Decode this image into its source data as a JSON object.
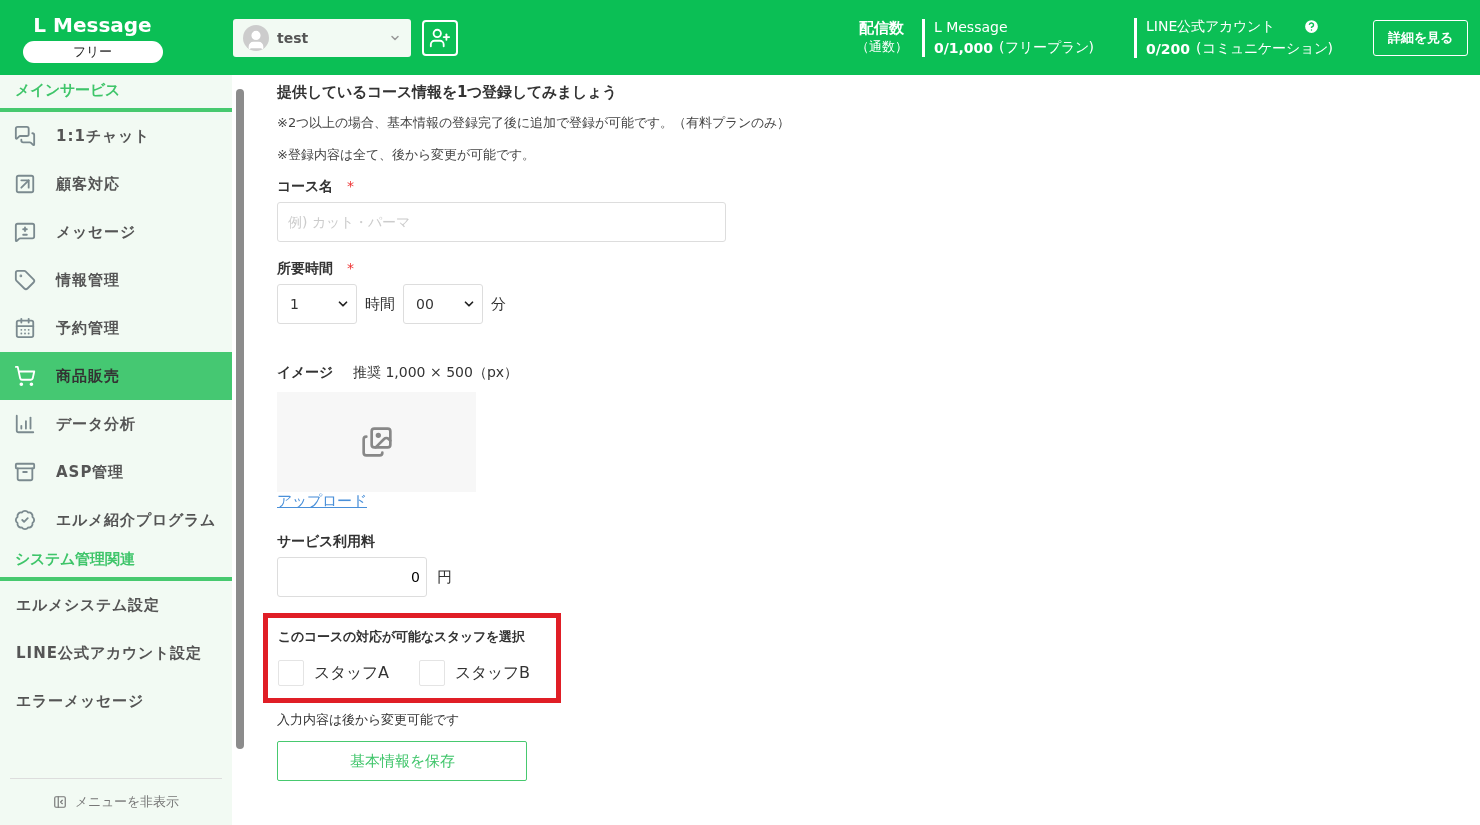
{
  "header": {
    "logo": "L Message",
    "plan_badge": "フリー",
    "account": {
      "name": "test"
    },
    "stats": {
      "label": "配信数",
      "sublabel": "（通数）",
      "items": [
        {
          "label": "L Message",
          "count": "0/1,000",
          "plan": "(フリープラン)",
          "help": false
        },
        {
          "label": "LINE公式アカウント",
          "count": "0/200",
          "plan": "(コミュニケーション)",
          "help": true
        }
      ]
    },
    "details_button": "詳細を見る"
  },
  "sidebar": {
    "sections": [
      {
        "title": "メインサービス",
        "items": [
          {
            "label": "1:1チャット",
            "selected": false
          },
          {
            "label": "顧客対応",
            "selected": false
          },
          {
            "label": "メッセージ",
            "selected": false
          },
          {
            "label": "情報管理",
            "selected": false
          },
          {
            "label": "予約管理",
            "selected": false
          },
          {
            "label": "商品販売",
            "selected": true
          },
          {
            "label": "データ分析",
            "selected": false
          },
          {
            "label": "ASP管理",
            "selected": false
          },
          {
            "label": "エルメ紹介プログラム",
            "selected": false
          }
        ]
      },
      {
        "title": "システム管理関連",
        "items": [
          {
            "label": "エルメシステム設定",
            "selected": false
          },
          {
            "label": "LINE公式アカウント設定",
            "selected": false
          },
          {
            "label": "エラーメッセージ",
            "selected": false
          }
        ]
      }
    ],
    "hide_menu": "メニューを非表示"
  },
  "form": {
    "heading": "提供しているコース情報を1つ登録してみましょう",
    "notes": [
      "※2つ以上の場合、基本情報の登録完了後に追加で登録が可能です。（有料プランのみ）",
      "※登録内容は全て、後から変更が可能です。"
    ],
    "course_name": {
      "label": "コース名",
      "required_mark": "*",
      "placeholder": "例) カット・パーマ"
    },
    "duration": {
      "label": "所要時間",
      "required_mark": "*",
      "hours": "1",
      "hour_unit": "時間",
      "minutes": "00",
      "minute_unit": "分"
    },
    "image": {
      "label": "イメージ",
      "hint": "推奨 1,000 × 500（px）",
      "upload": "アップロード"
    },
    "fee": {
      "label": "サービス利用料",
      "value": "0",
      "unit": "円"
    },
    "staff": {
      "title": "このコースの対応が可能なスタッフを選択",
      "options": [
        {
          "label": "スタッフA",
          "checked": false
        },
        {
          "label": "スタッフB",
          "checked": false
        }
      ]
    },
    "footnote": "入力内容は後から変更可能です",
    "save_button": "基本情報を保存"
  }
}
